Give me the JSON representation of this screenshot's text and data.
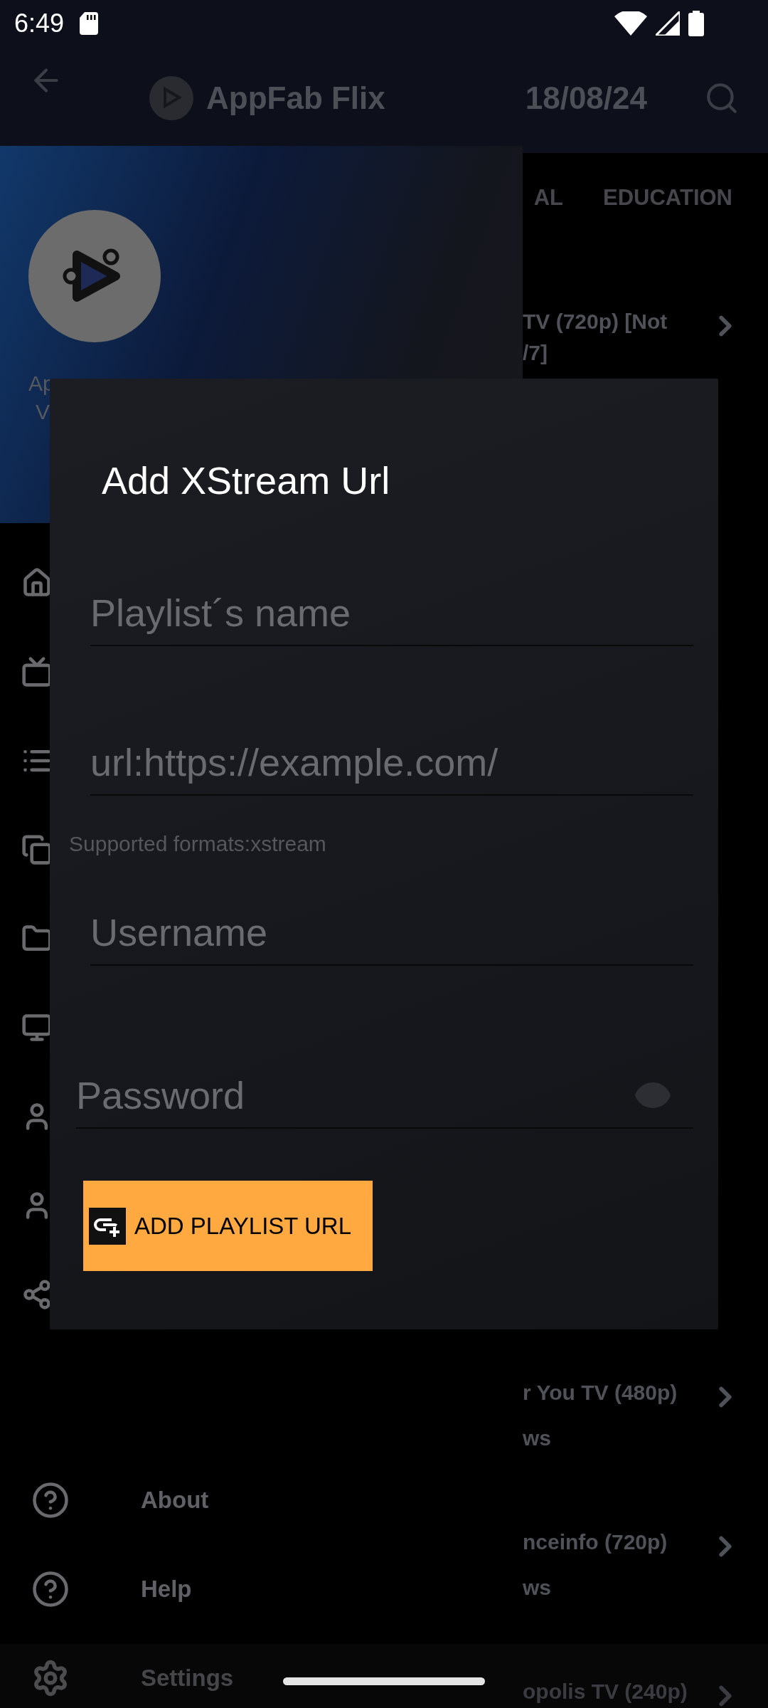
{
  "status_bar": {
    "time": "6:49"
  },
  "app_bar": {
    "title": "AppFab Flix",
    "date": "18/08/24"
  },
  "tabs": [
    {
      "label": "AL"
    },
    {
      "label": "EDUCATION"
    }
  ],
  "channels": [
    {
      "title": "TV (720p) [Not",
      "title_line_2": "/7]"
    },
    {
      "title": "r You TV (480p)",
      "subtitle": "ws"
    },
    {
      "title": "nceinfo (720p)",
      "subtitle": "ws"
    },
    {
      "title": "opolis TV (240p)"
    }
  ],
  "drawer": {
    "header_lines": [
      "Ap",
      "V"
    ],
    "items": [
      {
        "kind": "help",
        "label": "About"
      },
      {
        "kind": "help",
        "label": "Help"
      },
      {
        "kind": "settings",
        "label": "Settings"
      }
    ]
  },
  "dialog": {
    "title": "Add XStream Url",
    "fields": [
      {
        "kind": "text",
        "placeholder": "Playlist´s name"
      },
      {
        "kind": "text",
        "placeholder": "url:https://example.com/",
        "helper": "Supported formats:xstream"
      },
      {
        "kind": "text",
        "placeholder": "Username"
      },
      {
        "kind": "password",
        "placeholder": "Password"
      }
    ],
    "button": "ADD PLAYLIST URL"
  }
}
